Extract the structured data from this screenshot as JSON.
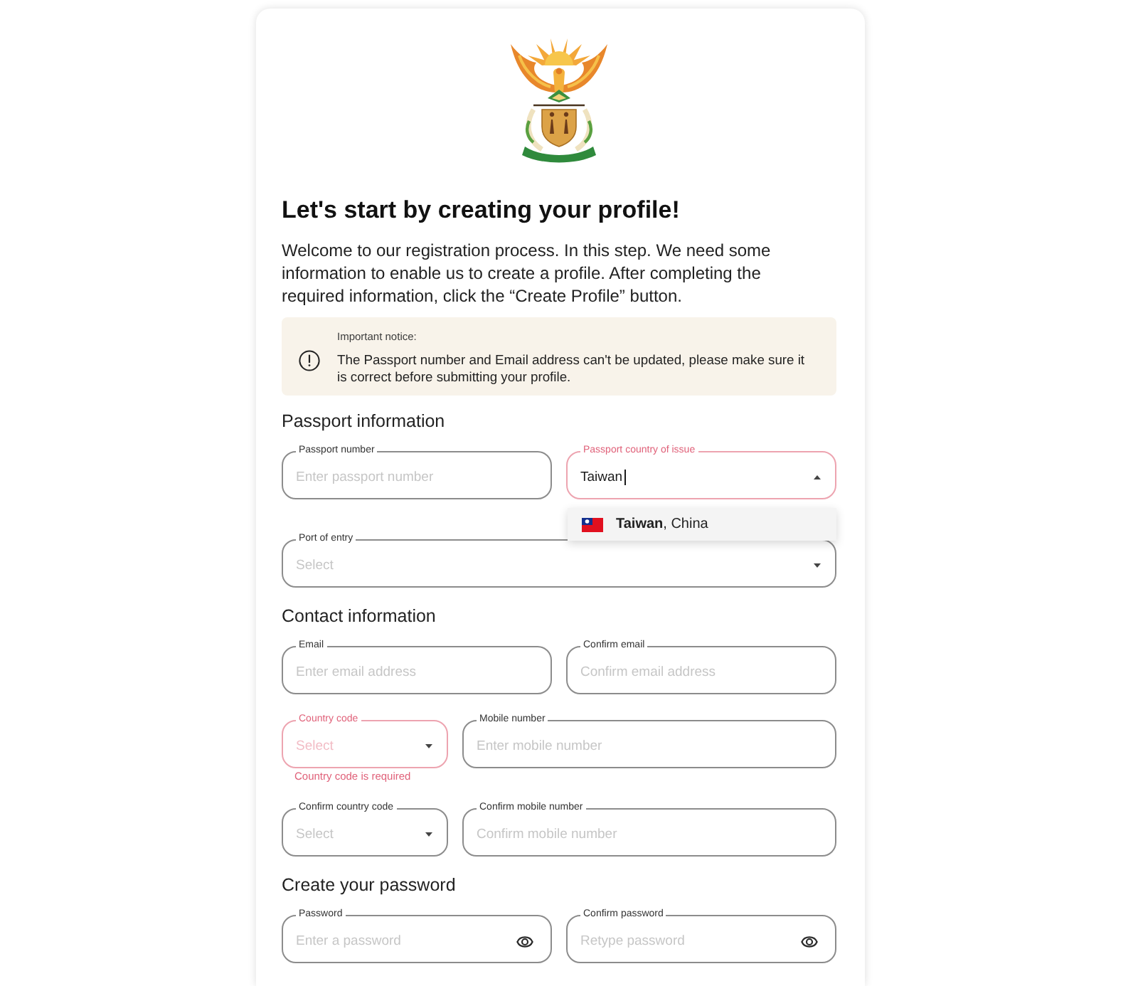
{
  "header": {
    "title": "Let's start by creating your profile!",
    "intro": "Welcome to our registration process. In this step. We need some information to enable us to create a profile. After completing the required information, click the “Create Profile” button."
  },
  "notice": {
    "heading": "Important notice:",
    "text": "The Passport number and Email address can't be updated, please make sure it is correct before submitting your profile."
  },
  "sections": [
    {
      "title": "Passport information",
      "rows": [
        {
          "fields": [
            {
              "kind": "text",
              "label": "Passport number",
              "placeholder": "Enter passport number",
              "focused": false,
              "error": false
            },
            {
              "kind": "select",
              "label": "Passport country of issue",
              "value": "Taiwan",
              "focused": true,
              "error": false,
              "expanded": true,
              "options": [
                {
                  "text": "**Taiwan**, China",
                  "highlighted": true
                }
              ]
            }
          ]
        },
        {
          "fields": [
            {
              "kind": "select",
              "label": "Port of entry",
              "placeholder": "Select",
              "focused": false,
              "error": false,
              "expanded": false
            }
          ]
        }
      ]
    },
    {
      "title": "Contact information",
      "rows": [
        {
          "fields": [
            {
              "kind": "text",
              "label": "Email",
              "placeholder": "Enter email address",
              "focused": false,
              "error": false
            },
            {
              "kind": "text",
              "label": "Confirm email",
              "placeholder": "Confirm email address",
              "focused": false,
              "error": false
            }
          ]
        },
        {
          "fields": [
            {
              "kind": "code",
              "label": "Country code",
              "placeholder": "Select",
              "focused": false,
              "error": true,
              "expanded": false,
              "error_message": "Country code is required"
            },
            {
              "kind": "text",
              "label": "Mobile number",
              "placeholder": "Enter mobile number",
              "focused": false,
              "error": false
            }
          ]
        },
        {
          "fields": [
            {
              "kind": "code",
              "label": "Confirm country code",
              "placeholder": "Select",
              "focused": false,
              "error": false,
              "expanded": false
            },
            {
              "kind": "text",
              "label": "Confirm mobile number",
              "placeholder": "Confirm mobile number",
              "focused": false,
              "error": false
            }
          ]
        }
      ]
    },
    {
      "title": "Create your password",
      "rows": [
        {
          "fields": [
            {
              "kind": "password",
              "label": "Password",
              "placeholder": "Enter a password",
              "focused": false,
              "error": false
            },
            {
              "kind": "password",
              "label": "Confirm password",
              "placeholder": "Retype password",
              "focused": false,
              "error": false
            }
          ]
        }
      ]
    }
  ]
}
